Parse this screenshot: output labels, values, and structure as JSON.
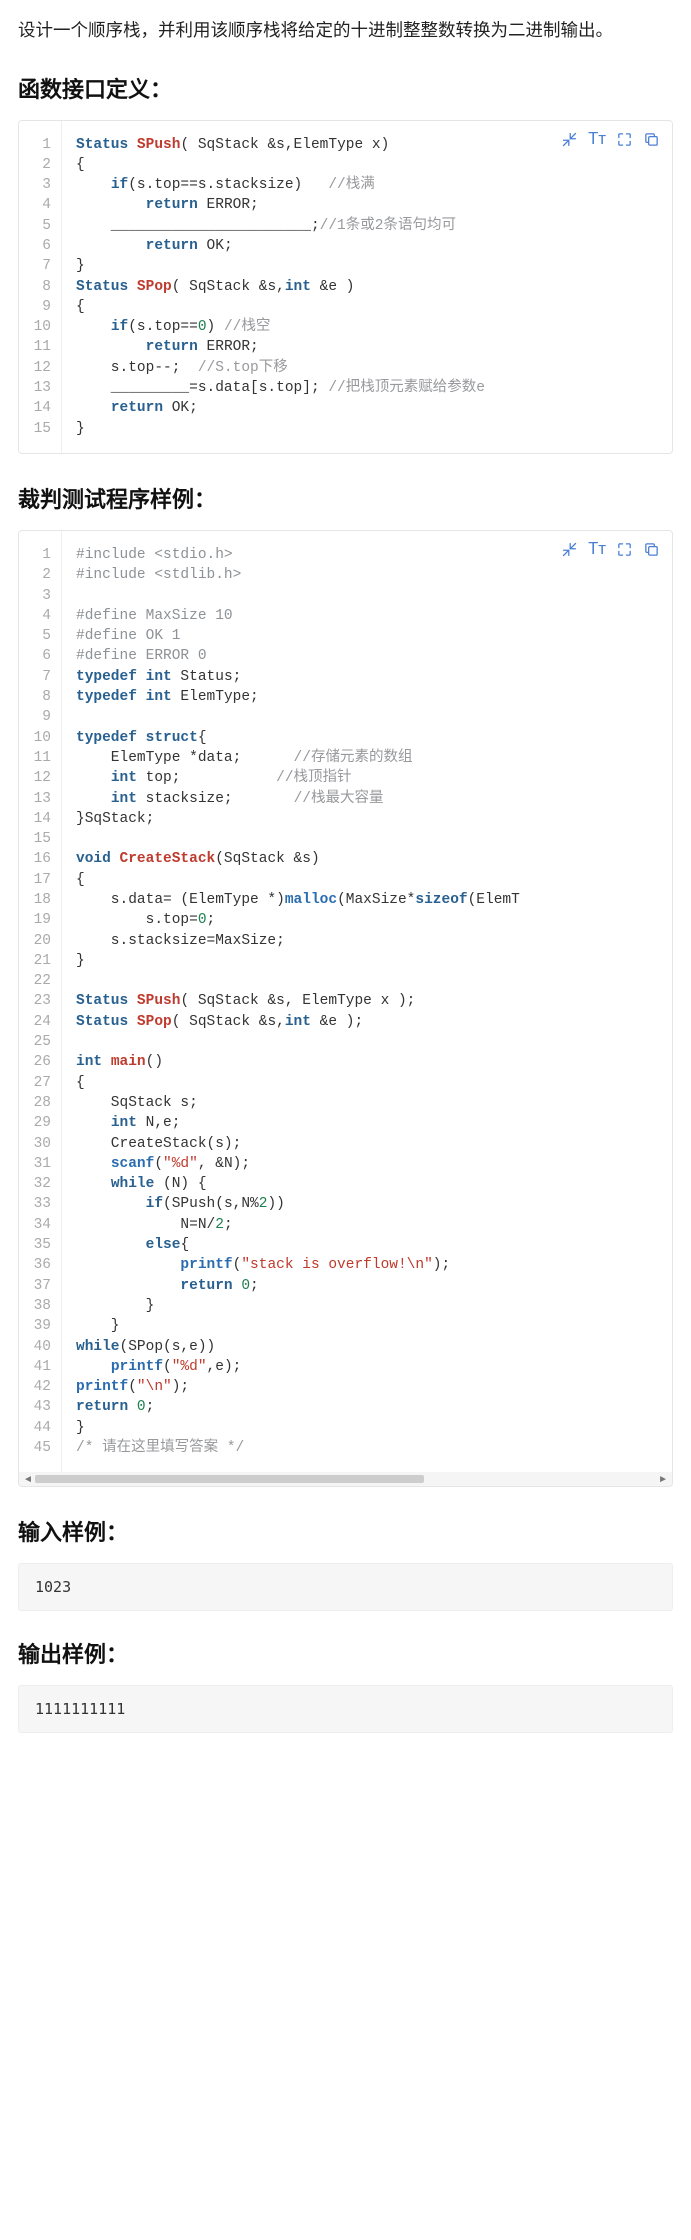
{
  "intro": "设计一个顺序栈，并利用该顺序栈将给定的十进制整整数转换为二进制输出。",
  "headings": {
    "interface": "函数接口定义：",
    "judge": "裁判测试程序样例：",
    "input": "输入样例：",
    "output": "输出样例："
  },
  "code1": {
    "lines": [
      {
        "n": "1",
        "h": "<span class='tok-type'>Status</span> <span class='tok-func'>SPush</span>( SqStack &amp;s,ElemType x)"
      },
      {
        "n": "2",
        "h": "{"
      },
      {
        "n": "3",
        "h": "    <span class='tok-kw'>if</span>(s.top==s.stacksize)   <span class='tok-cm'>//栈满</span>"
      },
      {
        "n": "4",
        "h": "        <span class='tok-kw'>return</span> ERROR;"
      },
      {
        "n": "5",
        "h": "    _______________________;<span class='tok-cm'>//1条或2条语句均可</span>"
      },
      {
        "n": "6",
        "h": "        <span class='tok-kw'>return</span> OK;"
      },
      {
        "n": "7",
        "h": "}"
      },
      {
        "n": "8",
        "h": "<span class='tok-type'>Status</span> <span class='tok-func'>SPop</span>( SqStack &amp;s,<span class='tok-type'>int</span> &amp;e )"
      },
      {
        "n": "9",
        "h": "{"
      },
      {
        "n": "10",
        "h": "    <span class='tok-kw'>if</span>(s.top==<span class='tok-num'>0</span>) <span class='tok-cm'>//栈空</span>"
      },
      {
        "n": "11",
        "h": "        <span class='tok-kw'>return</span> ERROR;"
      },
      {
        "n": "12",
        "h": "    s.top--;  <span class='tok-cm'>//S.top下移</span>"
      },
      {
        "n": "13",
        "h": "    _________=s.data[s.top]; <span class='tok-cm'>//把栈顶元素赋给参数e</span>"
      },
      {
        "n": "14",
        "h": "    <span class='tok-kw'>return</span> OK;"
      },
      {
        "n": "15",
        "h": "}"
      }
    ]
  },
  "code2": {
    "lines": [
      {
        "n": "1",
        "h": "<span class='tok-pre'>#include &lt;stdio.h&gt;</span>"
      },
      {
        "n": "2",
        "h": "<span class='tok-pre'>#include &lt;stdlib.h&gt;</span>"
      },
      {
        "n": "3",
        "h": ""
      },
      {
        "n": "4",
        "h": "<span class='tok-pre'>#define MaxSize 10</span>"
      },
      {
        "n": "5",
        "h": "<span class='tok-pre'>#define OK 1</span>"
      },
      {
        "n": "6",
        "h": "<span class='tok-pre'>#define ERROR 0</span>"
      },
      {
        "n": "7",
        "h": "<span class='tok-type'>typedef</span> <span class='tok-type'>int</span> Status;"
      },
      {
        "n": "8",
        "h": "<span class='tok-type'>typedef</span> <span class='tok-type'>int</span> ElemType;"
      },
      {
        "n": "9",
        "h": ""
      },
      {
        "n": "10",
        "h": "<span class='tok-type'>typedef</span> <span class='tok-type'>struct</span>{"
      },
      {
        "n": "11",
        "h": "    ElemType *data;      <span class='tok-cm'>//存储元素的数组</span>"
      },
      {
        "n": "12",
        "h": "    <span class='tok-type'>int</span> top;           <span class='tok-cm'>//栈顶指针</span>"
      },
      {
        "n": "13",
        "h": "    <span class='tok-type'>int</span> stacksize;       <span class='tok-cm'>//栈最大容量</span>"
      },
      {
        "n": "14",
        "h": "}SqStack;"
      },
      {
        "n": "15",
        "h": ""
      },
      {
        "n": "16",
        "h": "<span class='tok-type'>void</span> <span class='tok-func'>CreateStack</span>(SqStack &amp;s)"
      },
      {
        "n": "17",
        "h": "{"
      },
      {
        "n": "18",
        "h": "    s.data= (ElemType *)<span class='tok-funcb'>malloc</span>(MaxSize*<span class='tok-kw tok-bold'>sizeof</span>(ElemT"
      },
      {
        "n": "19",
        "h": "        s.top=<span class='tok-num'>0</span>;"
      },
      {
        "n": "20",
        "h": "    s.stacksize=MaxSize;"
      },
      {
        "n": "21",
        "h": "}"
      },
      {
        "n": "22",
        "h": ""
      },
      {
        "n": "23",
        "h": "<span class='tok-type'>Status</span> <span class='tok-func'>SPush</span>( SqStack &amp;s, ElemType x );"
      },
      {
        "n": "24",
        "h": "<span class='tok-type'>Status</span> <span class='tok-func'>SPop</span>( SqStack &amp;s,<span class='tok-type'>int</span> &amp;e );"
      },
      {
        "n": "25",
        "h": ""
      },
      {
        "n": "26",
        "h": "<span class='tok-type'>int</span> <span class='tok-func'>main</span>()"
      },
      {
        "n": "27",
        "h": "{"
      },
      {
        "n": "28",
        "h": "    SqStack s;"
      },
      {
        "n": "29",
        "h": "    <span class='tok-type'>int</span> N,e;"
      },
      {
        "n": "30",
        "h": "    CreateStack(s);"
      },
      {
        "n": "31",
        "h": "    <span class='tok-funcb'>scanf</span>(<span class='tok-str'>\"%d\"</span>, &amp;N);"
      },
      {
        "n": "32",
        "h": "    <span class='tok-kw'>while</span> (N) {"
      },
      {
        "n": "33",
        "h": "        <span class='tok-kw'>if</span>(SPush(s,N%<span class='tok-num'>2</span>))"
      },
      {
        "n": "34",
        "h": "            N=N/<span class='tok-num'>2</span>;"
      },
      {
        "n": "35",
        "h": "        <span class='tok-kw'>else</span>{"
      },
      {
        "n": "36",
        "h": "            <span class='tok-funcb'>printf</span>(<span class='tok-str'>\"stack is overflow!\\n\"</span>);"
      },
      {
        "n": "37",
        "h": "            <span class='tok-kw'>return</span> <span class='tok-num'>0</span>;"
      },
      {
        "n": "38",
        "h": "        }"
      },
      {
        "n": "39",
        "h": "    }"
      },
      {
        "n": "40",
        "h": "<span class='tok-kw'>while</span>(SPop(s,e))"
      },
      {
        "n": "41",
        "h": "    <span class='tok-funcb'>printf</span>(<span class='tok-str'>\"%d\"</span>,e);"
      },
      {
        "n": "42",
        "h": "<span class='tok-funcb'>printf</span>(<span class='tok-str'>\"\\n\"</span>);"
      },
      {
        "n": "43",
        "h": "<span class='tok-kw'>return</span> <span class='tok-num'>0</span>;"
      },
      {
        "n": "44",
        "h": "}"
      },
      {
        "n": "45",
        "h": "<span class='tok-cm'>/* 请在这里填写答案 */</span>"
      }
    ]
  },
  "samples": {
    "input": "1023",
    "output": "1111111111"
  },
  "icons": {
    "shrink": "shrink-icon",
    "font": "Tᴛ",
    "expand": "expand-icon",
    "copy": "copy-icon"
  }
}
